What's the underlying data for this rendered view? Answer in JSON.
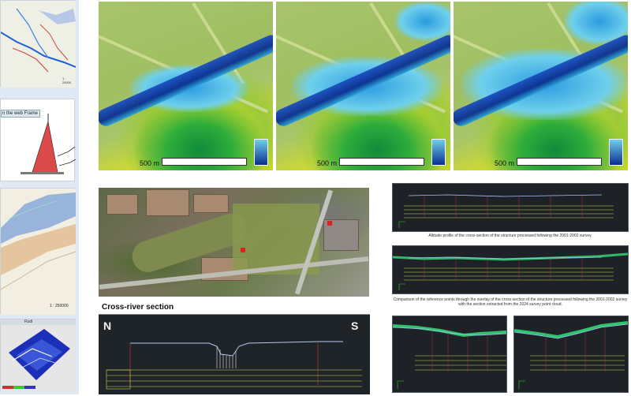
{
  "left_strip": {
    "label_web_frame": "n the web Frame",
    "label_scale_1": "1 : 20000",
    "label_scale_2": "1 : 250000",
    "label_panel_title": "Rudi"
  },
  "dem_panels": [
    {
      "scale_label": "500 m"
    },
    {
      "scale_label": "500 m"
    },
    {
      "scale_label": "500 m"
    }
  ],
  "cross_section": {
    "title": "Cross-river section",
    "left_bank": "N",
    "right_bank": "S"
  },
  "captions": {
    "caption_1": "Altitude profile of the cross-section of the structure processed following the 2001-2002 survey.",
    "caption_2": "Comparison of the reference points through the overlay of the cross-section of the structure processed following the 2001-2002 survey with the section extracted from the 2024 survey point cloud."
  },
  "colors": {
    "water_dark": "#0a2f8f",
    "water_light": "#6fd0ec",
    "terrain_green": "#2fae3b",
    "terrain_yellow": "#e2e019",
    "cad_background": "#1e2226",
    "cad_grid": "#c9d34a",
    "cad_marker": "#c43a3a",
    "cloud_green": "#33e07a"
  }
}
